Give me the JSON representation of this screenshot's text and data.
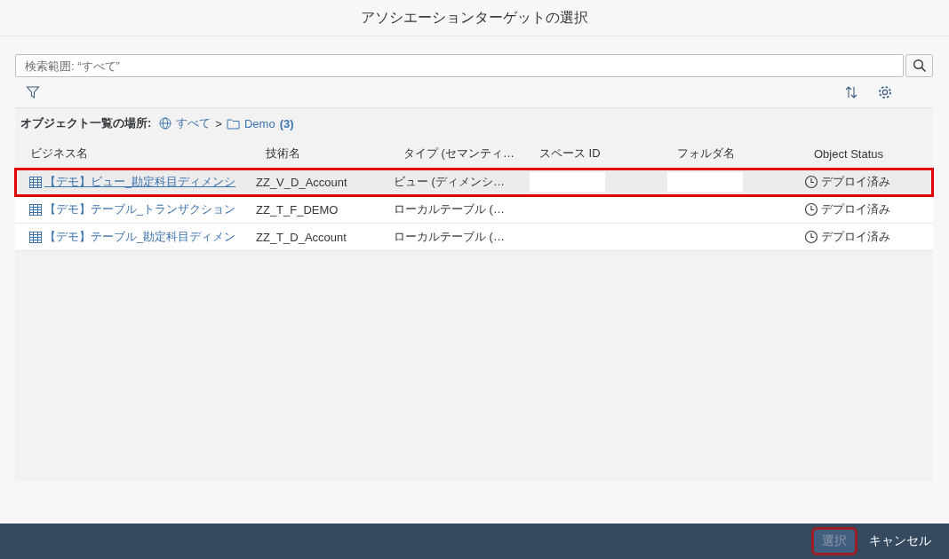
{
  "dialog": {
    "title": "アソシエーションターゲットの選択"
  },
  "search": {
    "placeholder": "検索範囲: “すべて”"
  },
  "breadcrumb": {
    "label": "オブジェクト一覧の場所:",
    "root": "すべて",
    "separator": ">",
    "folder": "Demo",
    "count": "(3)"
  },
  "table": {
    "columns": [
      "ビジネス名",
      "技術名",
      "タイプ (セマンティ…",
      "スペース ID",
      "フォルダ名",
      "Object Status"
    ],
    "rows": [
      {
        "business_name": "【デモ】ビュー_勘定科目ディメンシ",
        "technical_name": "ZZ_V_D_Account",
        "type": "ビュー (ディメンシ…",
        "redacted": true,
        "status": "デプロイ済み",
        "selected": true,
        "highlighted": true
      },
      {
        "business_name": "【デモ】テーブル_トランザクション",
        "technical_name": "ZZ_T_F_DEMO",
        "type": "ローカルテーブル (…",
        "redacted": false,
        "status": "デプロイ済み",
        "selected": false,
        "highlighted": false
      },
      {
        "business_name": "【デモ】テーブル_勘定科目ディメン",
        "technical_name": "ZZ_T_D_Account",
        "type": "ローカルテーブル (…",
        "redacted": false,
        "status": "デプロイ済み",
        "selected": false,
        "highlighted": false
      }
    ]
  },
  "footer": {
    "buttons": [
      {
        "label": "選択",
        "kind": "primary",
        "disabled": true,
        "highlighted": true
      },
      {
        "label": "キャンセル",
        "kind": "transparent",
        "disabled": false,
        "highlighted": false
      }
    ]
  }
}
